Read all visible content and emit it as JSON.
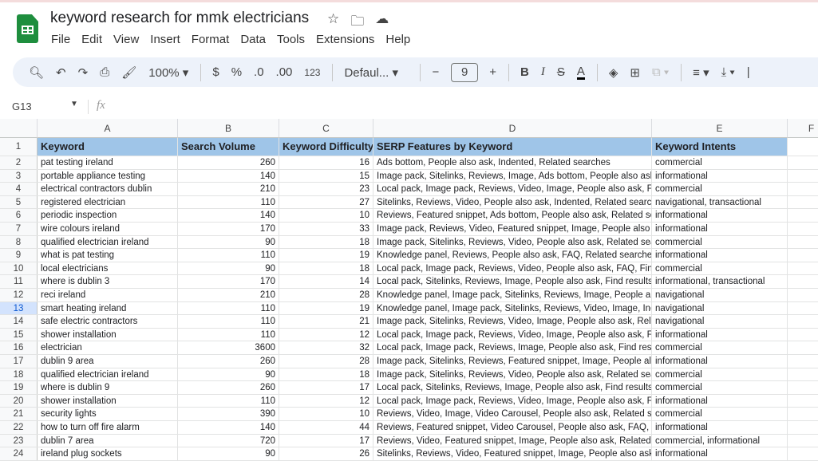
{
  "app": {
    "title": "keyword research for mmk electricians",
    "menu": [
      "File",
      "Edit",
      "View",
      "Insert",
      "Format",
      "Data",
      "Tools",
      "Extensions",
      "Help"
    ]
  },
  "toolbar": {
    "zoom": "100%",
    "currency": "$",
    "percent": "%",
    "dec_decrease": ".0",
    "dec_increase": ".00",
    "format_123": "123",
    "font": "Defaul...",
    "font_size": "9",
    "minus": "−",
    "plus": "+",
    "bold": "B",
    "italic": "I",
    "text_color": "A"
  },
  "formula_bar": {
    "cell_ref": "G13",
    "fx": "fx",
    "value": ""
  },
  "sheet": {
    "columns": [
      "A",
      "B",
      "C",
      "D",
      "E",
      "F"
    ],
    "selected_row": 13,
    "headers": [
      "Keyword",
      "Search Volume",
      "Keyword Difficulty",
      "SERP Features by Keyword",
      "Keyword Intents"
    ],
    "header_color": "#9fc5e8",
    "rows": [
      [
        "pat testing ireland",
        "260",
        "16",
        "Ads bottom, People also ask, Indented, Related searches",
        "commercial"
      ],
      [
        "portable appliance testing",
        "140",
        "15",
        "Image pack, Sitelinks, Reviews, Image, Ads bottom, People also ask, I",
        "informational"
      ],
      [
        "electrical contractors dublin",
        "210",
        "23",
        "Local pack, Image pack, Reviews, Video, Image, People also ask, Find",
        "commercial"
      ],
      [
        "registered electrician",
        "110",
        "27",
        "Sitelinks, Reviews, Video, People also ask, Indented, Related searche",
        "navigational, transactional"
      ],
      [
        "periodic inspection",
        "140",
        "10",
        "Reviews, Featured snippet, Ads bottom, People also ask, Related sea",
        "informational"
      ],
      [
        "wire colours ireland",
        "170",
        "33",
        "Image pack, Reviews, Video, Featured snippet, Image, People also as",
        "informational"
      ],
      [
        "qualified electrician ireland",
        "90",
        "18",
        "Image pack, Sitelinks, Reviews, Video, People also ask, Related searcl",
        "commercial"
      ],
      [
        "what is pat testing",
        "110",
        "19",
        "Knowledge panel, Reviews, People also ask, FAQ, Related searches",
        "informational"
      ],
      [
        "local electricians",
        "90",
        "18",
        "Local pack, Image pack, Reviews, Video, People also ask, FAQ, Find re",
        "commercial"
      ],
      [
        "where is dublin 3",
        "170",
        "14",
        "Local pack, Sitelinks, Reviews, Image, People also ask, Find results on",
        "informational, transactional"
      ],
      [
        "reci ireland",
        "210",
        "28",
        "Knowledge panel, Image pack, Sitelinks, Reviews, Image, People also",
        "navigational"
      ],
      [
        "smart heating ireland",
        "110",
        "19",
        "Knowledge panel, Image pack, Sitelinks, Reviews, Video, Image, Inde",
        "navigational"
      ],
      [
        "safe electric contractors",
        "110",
        "21",
        "Image pack, Sitelinks, Reviews, Video, Image, People also ask, Relate",
        "navigational"
      ],
      [
        "shower installation",
        "110",
        "12",
        "Local pack, Image pack, Reviews, Video, Image, People also ask, Find",
        "informational"
      ],
      [
        "electrician",
        "3600",
        "32",
        "Local pack, Image pack, Reviews, Image, People also ask, Find results",
        "commercial"
      ],
      [
        "dublin 9 area",
        "260",
        "28",
        "Image pack, Sitelinks, Reviews, Featured snippet, Image, People also",
        "informational"
      ],
      [
        "qualified electrician ireland",
        "90",
        "18",
        "Image pack, Sitelinks, Reviews, Video, People also ask, Related searcl",
        "commercial"
      ],
      [
        "where is dublin 9",
        "260",
        "17",
        "Local pack, Sitelinks, Reviews, Image, People also ask, Find results on",
        "commercial"
      ],
      [
        "shower installation",
        "110",
        "12",
        "Local pack, Image pack, Reviews, Video, Image, People also ask, Find",
        "informational"
      ],
      [
        "security lights",
        "390",
        "10",
        "Reviews, Video, Image, Video Carousel, People also ask, Related sear",
        "commercial"
      ],
      [
        "how to turn off fire alarm",
        "140",
        "44",
        "Reviews, Featured snippet, Video Carousel, People also ask, FAQ, Inc",
        "informational"
      ],
      [
        "dublin 7 area",
        "720",
        "17",
        "Reviews, Video, Featured snippet, Image, People also ask, Related se",
        "commercial, informational"
      ],
      [
        "ireland plug sockets",
        "90",
        "26",
        "Sitelinks, Reviews, Video, Featured snippet, Image, People also ask, F",
        "informational"
      ]
    ]
  }
}
